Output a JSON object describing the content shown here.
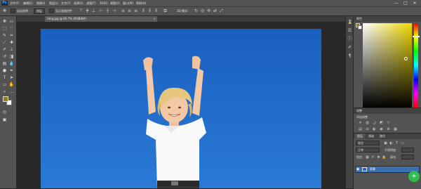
{
  "app": {
    "logo": "Ps",
    "menu": [
      "文件(F)",
      "编辑(E)",
      "图像(I)",
      "图层(L)",
      "文字(Y)",
      "选择(S)",
      "滤镜(T)",
      "3D(D)",
      "视图(V)",
      "窗口(W)",
      "帮助(H)"
    ]
  },
  "window_controls": {
    "minimize": "—",
    "maximize": "□",
    "close": "✕"
  },
  "options_bar": {
    "auto_select_label": "自动选择:",
    "auto_select_value": "图层",
    "show_transform_label": "显示变换控件",
    "mode_3d_label": "3D 模式:"
  },
  "document": {
    "tab_title": "timg.jpg @ 66.7% (RGB/8#)",
    "tab_close": "×"
  },
  "colors": {
    "foreground": "#8b8218",
    "background": "#ffffff",
    "accent": "#3c6fb0",
    "sky": "#1c67c4"
  },
  "panels": {
    "color_title": "颜色",
    "adjustments_title": "调整",
    "adjustments_subtitle": "添加调整",
    "layers_tabs": [
      "图层",
      "通道",
      "路径"
    ],
    "kind_label": "类型",
    "blend_mode": "正常",
    "opacity_label": "不透明度:",
    "lock_label": "锁定:",
    "fill_label": "填充:",
    "layer_name": "背景"
  },
  "icons": [
    "move-tool-icon",
    "marquee-tool-icon",
    "lasso-tool-icon",
    "quick-select-icon",
    "crop-tool-icon",
    "eyedropper-icon",
    "healing-brush-icon",
    "brush-tool-icon",
    "stamp-tool-icon",
    "history-brush-icon",
    "eraser-icon",
    "gradient-icon",
    "blur-icon",
    "dodge-icon",
    "pen-tool-icon",
    "type-tool-icon",
    "path-select-icon",
    "shape-tool-icon",
    "hand-tool-icon",
    "zoom-tool-icon"
  ]
}
